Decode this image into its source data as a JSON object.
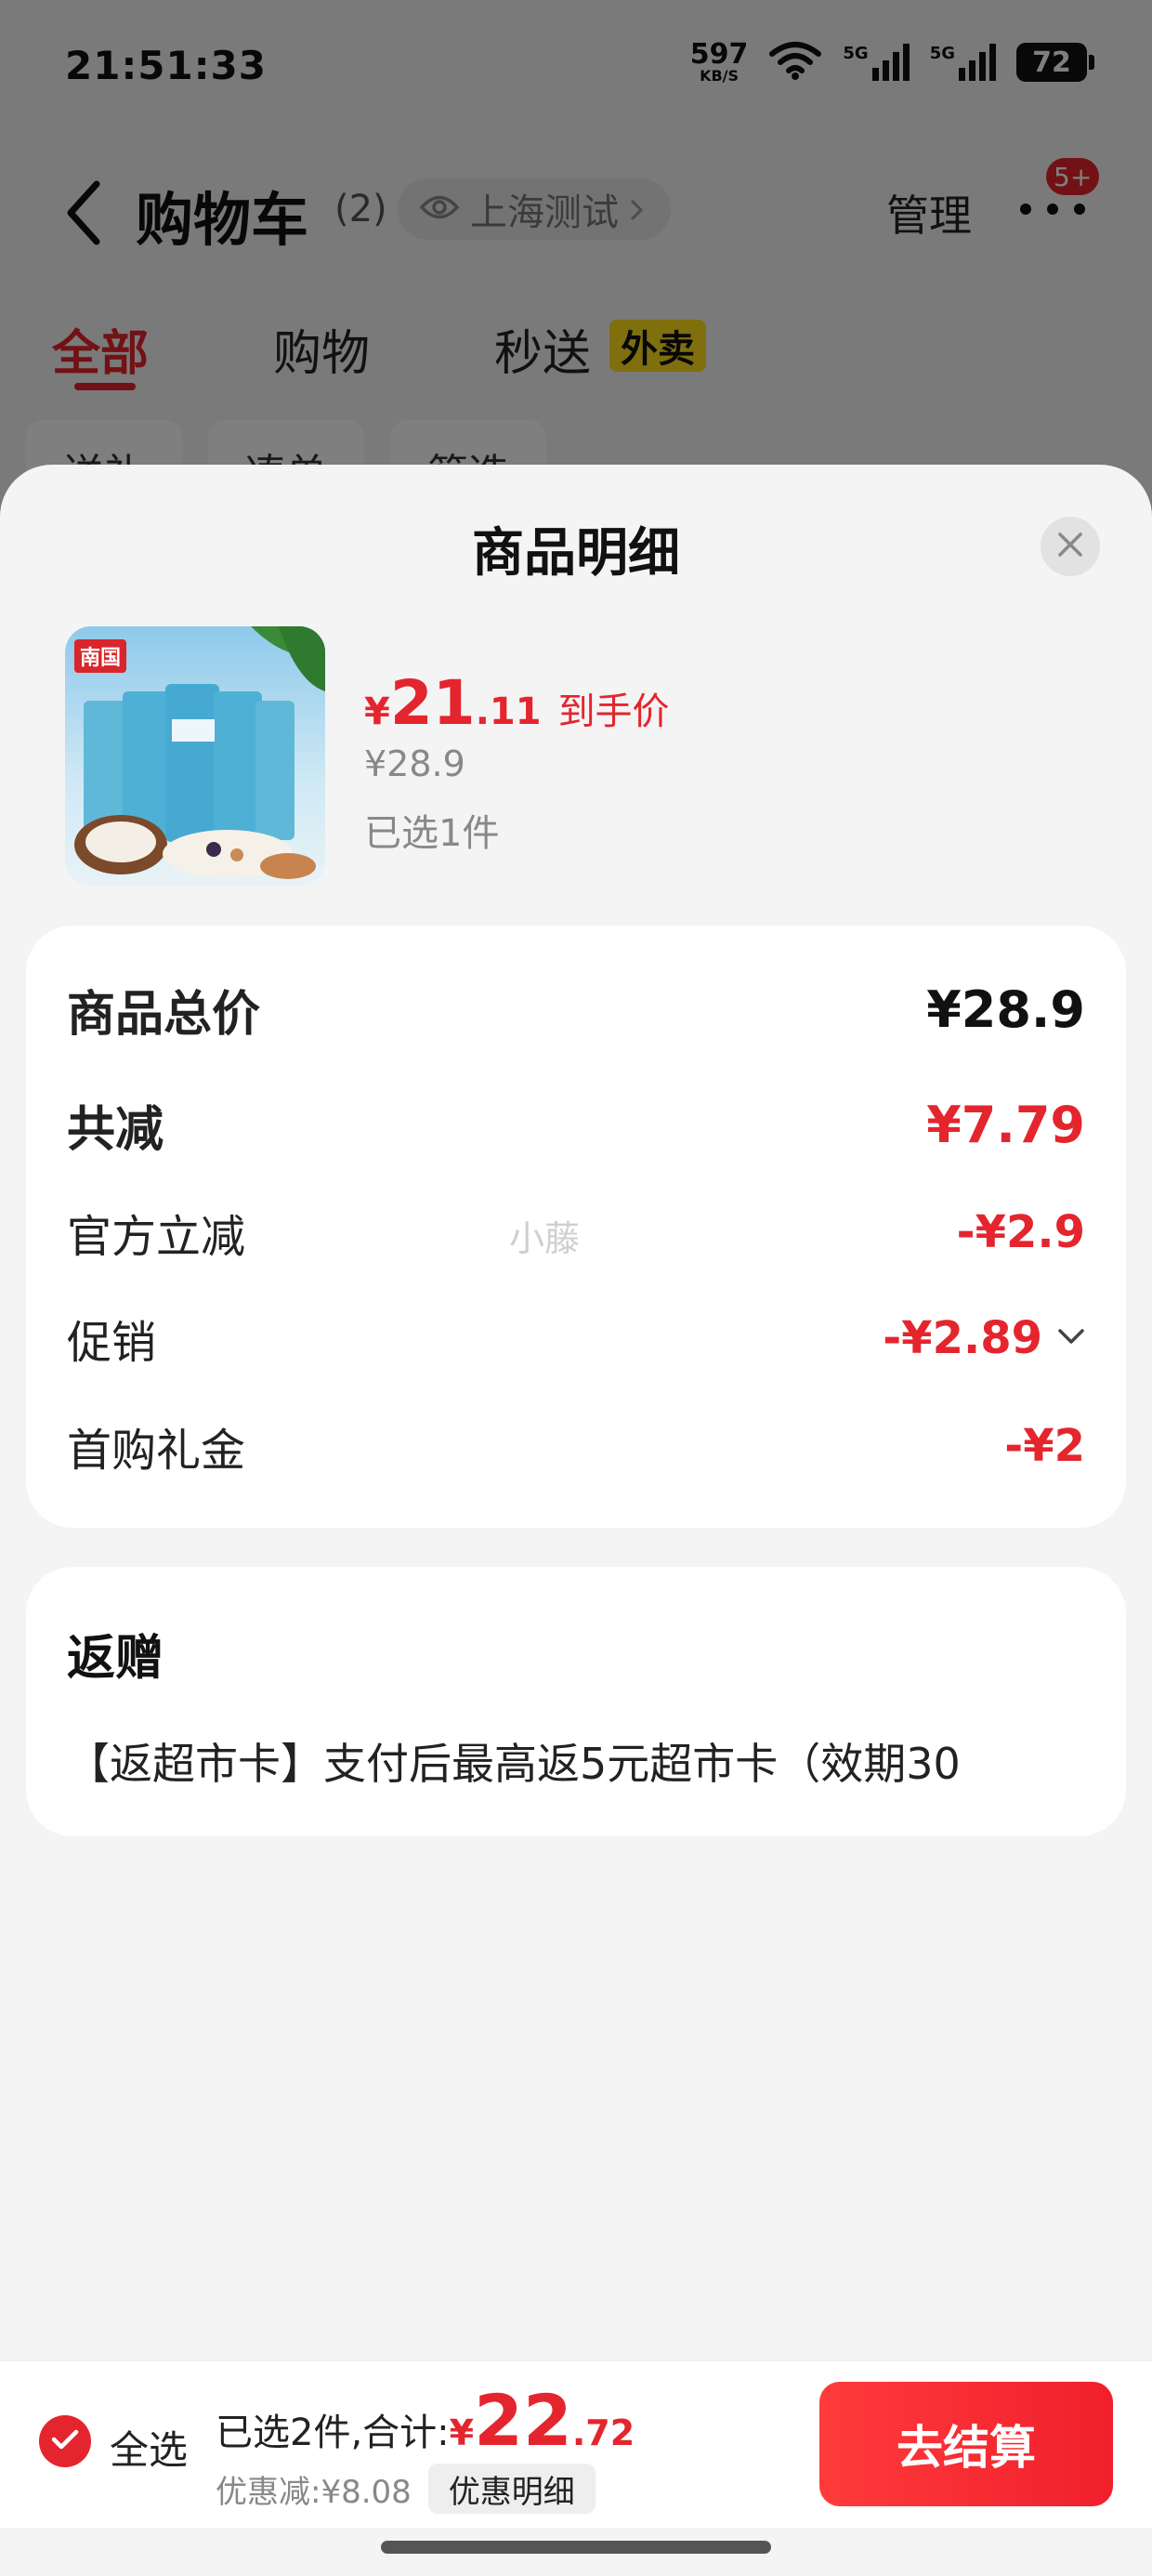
{
  "status_bar": {
    "time": "21:51:33",
    "net_speed": "597",
    "net_unit": "KB/S",
    "signal_1": "5G",
    "signal_2": "5G",
    "battery": "72"
  },
  "nav": {
    "title": "购物车",
    "count": "(2)",
    "location": "上海测试",
    "manage": "管理",
    "more_badge": "5+"
  },
  "tabs": [
    {
      "label": "全部",
      "active": true
    },
    {
      "label": "购物"
    },
    {
      "label": "秒送",
      "tag": "外卖"
    }
  ],
  "filters": [
    "送礼",
    "凑单",
    "筛选"
  ],
  "sheet": {
    "title": "商品明细",
    "product": {
      "brand": "南国",
      "price_currency": "¥",
      "price_int": "21",
      "price_dec": ".11",
      "price_tag": "到手价",
      "original_price": "¥28.9",
      "selected": "已选1件"
    },
    "summary": [
      {
        "label": "商品总价",
        "value": "¥28.9",
        "bold": true
      },
      {
        "label": "共减",
        "value": "¥7.79",
        "bold": true,
        "red": true
      },
      {
        "label": "官方立减",
        "value": "-¥2.9",
        "red": true
      },
      {
        "label": "促销",
        "value": "-¥2.89",
        "red": true,
        "expandable": true
      },
      {
        "label": "首购礼金",
        "value": "-¥2",
        "red": true
      }
    ],
    "watermark": "小藤",
    "gift": {
      "title": "返赠",
      "text": "【返超市卡】支付后最高返5元超市卡（效期30"
    }
  },
  "checkout": {
    "select_all": "全选",
    "total_label": "已选2件,合计:",
    "total_currency": "¥",
    "total_int": "22",
    "total_dec": ".72",
    "discount_text": "优惠减:¥8.08",
    "discount_detail": "优惠明细",
    "checkout_button": "去结算"
  },
  "colors": {
    "accent": "#e4252d",
    "tag_yellow": "#ffde1a",
    "sheet_bg": "#f4f4f4"
  }
}
